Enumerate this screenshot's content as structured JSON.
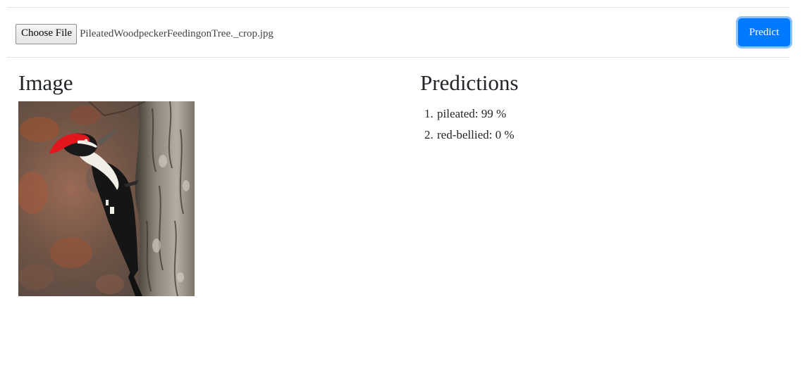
{
  "file_input": {
    "button_label": "Choose File",
    "file_name": "PileatedWoodpeckerFeedingonTree._crop.jpg"
  },
  "predict_button": {
    "label": "Predict",
    "color": "#007bff"
  },
  "image_section": {
    "title": "Image",
    "photo_icon": "pileated-woodpecker-photo"
  },
  "predictions_section": {
    "title": "Predictions",
    "items": [
      {
        "number": "1.",
        "text": "pileated: 99 %"
      },
      {
        "number": "2.",
        "text": "red-bellied: 0 %"
      }
    ]
  }
}
